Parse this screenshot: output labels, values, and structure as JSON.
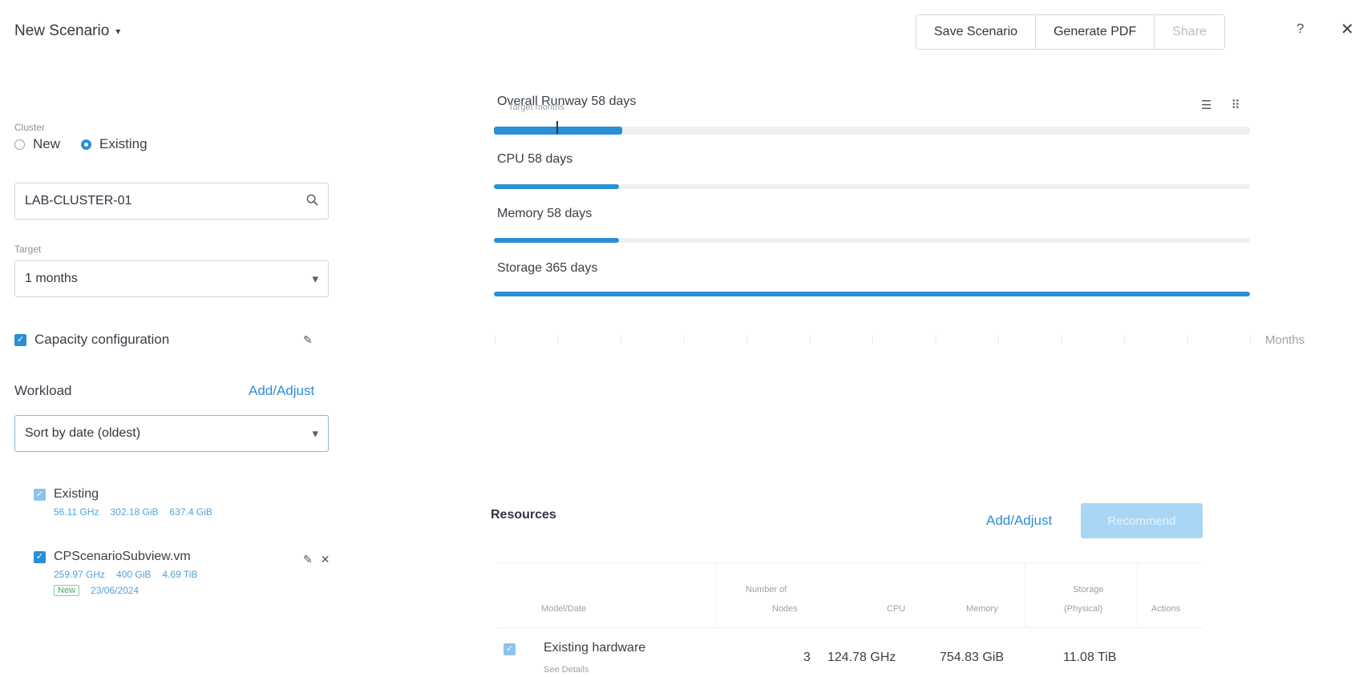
{
  "header": {
    "title": "New Scenario",
    "buttons": {
      "save": "Save Scenario",
      "pdf": "Generate PDF",
      "share": "Share"
    },
    "help": "?",
    "close": "✕"
  },
  "left": {
    "cluster_label": "Cluster",
    "radio_new": "New",
    "radio_existing": "Existing",
    "cluster_value": "LAB-CLUSTER-01",
    "target_label": "Target",
    "target_value": "1 months",
    "capacity_label": "Capacity configuration",
    "workload_label": "Workload",
    "add_adjust": "Add/Adjust",
    "sort_value": "Sort by date (oldest)",
    "items": [
      {
        "name": "Existing",
        "cpu": "56.11 GHz",
        "mem": "302.18 GiB",
        "storage": "637.4 GiB"
      },
      {
        "name": "CPScenarioSubview.vm",
        "cpu": "259.97 GHz",
        "mem": "400 GiB",
        "storage": "4.69 TiB",
        "badge": "New",
        "date": "23/06/2024"
      }
    ]
  },
  "runway": {
    "overall": "Overall Runway 58 days",
    "overlap_text": "Target months",
    "cpu": "CPU 58 days",
    "memory": "Memory 58 days",
    "storage": "Storage 365 days",
    "months": "Months"
  },
  "resources": {
    "title": "Resources",
    "add_adjust": "Add/Adjust",
    "recommend": "Recommend",
    "columns": {
      "model": "Model/Date",
      "nodes_1": "Number of",
      "nodes_2": "Nodes",
      "cpu": "CPU",
      "memory": "Memory",
      "storage_1": "Storage",
      "storage_2": "(Physical)",
      "actions": "Actions"
    },
    "rows": [
      {
        "model": "Existing hardware",
        "sub": "See Details",
        "nodes": "3",
        "cpu": "124.78 GHz",
        "memory": "754.83 GiB",
        "storage": "11.08 TiB"
      }
    ]
  },
  "colors": {
    "accent": "#2b8fd6",
    "track": "#eef0f2",
    "recommend_disabled": "#a9d6f4"
  }
}
